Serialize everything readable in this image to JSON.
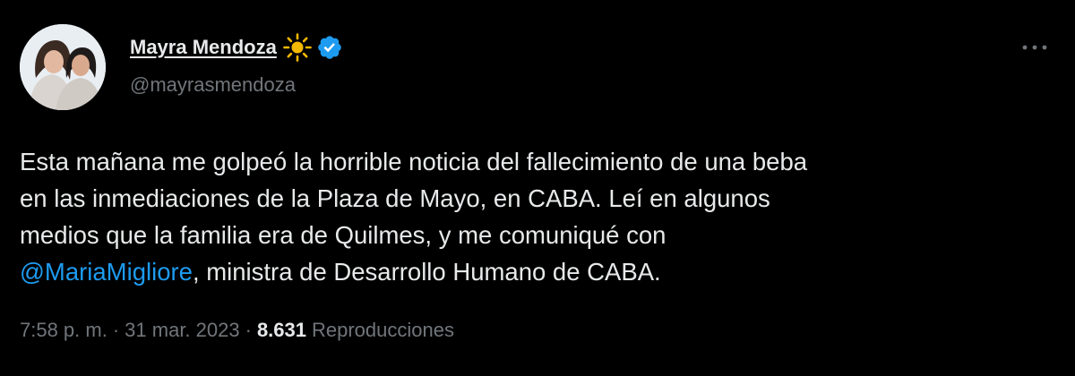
{
  "author": {
    "display_name": "Mayra Mendoza",
    "handle": "@mayrasmendoza",
    "name_emoji": "sun",
    "verified": true
  },
  "tweet": {
    "lines": [
      "Esta mañana me golpeó la horrible noticia del fallecimiento de una beba",
      "en las inmediaciones de la Plaza de Mayo, en CABA. Leí en algunos",
      "medios que la familia era de Quilmes, y me comuniqué con"
    ],
    "mention": "@MariaMigliore",
    "last_line_rest": ", ministra de Desarrollo Humano de CABA."
  },
  "meta": {
    "time": "7:58 p. m.",
    "separator": "·",
    "date": "31 mar. 2023",
    "views_count": "8.631",
    "views_label": "Reproducciones"
  },
  "colors": {
    "background": "#000000",
    "text": "#e7e9ea",
    "secondary": "#71767b",
    "link": "#1d9bf0",
    "verified": "#1d9bf0",
    "sun": "#f5b800"
  },
  "icons": {
    "more": "more-horizontal-icon",
    "verified": "verified-badge-icon",
    "emoji": "sun-icon"
  }
}
